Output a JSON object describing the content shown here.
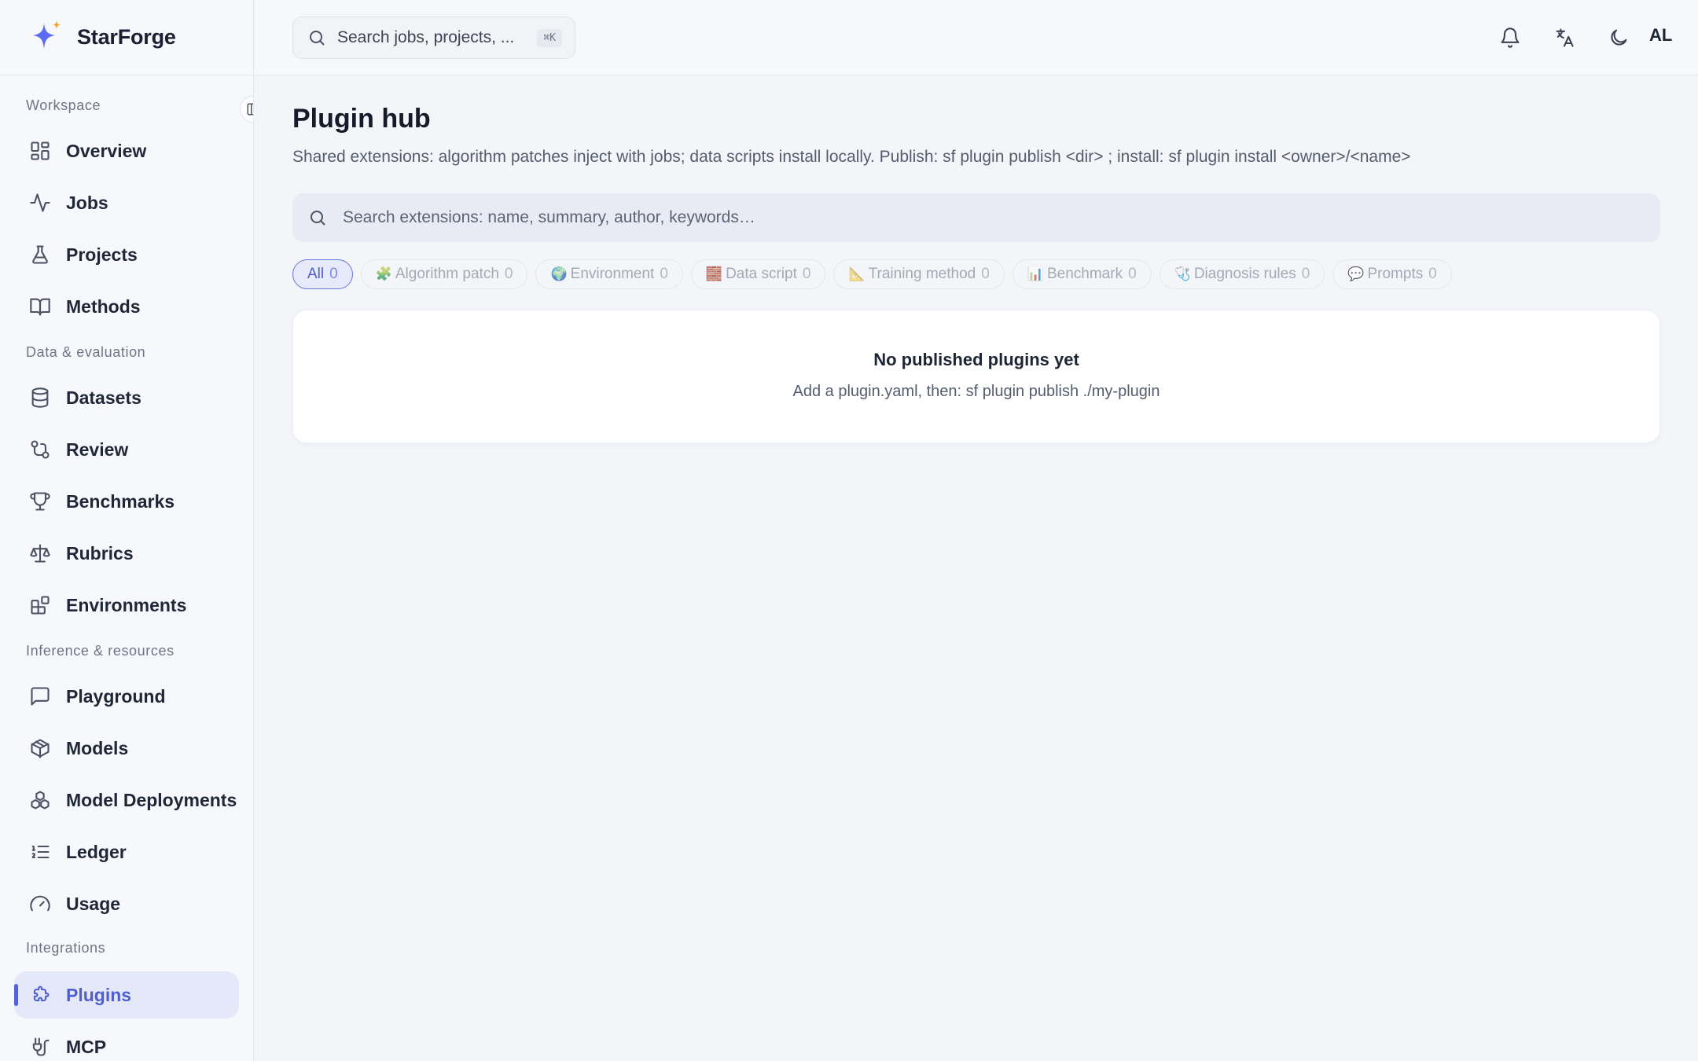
{
  "app": {
    "name": "StarForge"
  },
  "topbar": {
    "search_placeholder": "Search jobs, projects, ...",
    "search_shortcut": "⌘K",
    "avatar_initials": "AL"
  },
  "sidebar": {
    "sections": [
      {
        "label": "Workspace"
      },
      {
        "label": "Data & evaluation"
      },
      {
        "label": "Inference & resources"
      },
      {
        "label": "Integrations"
      }
    ],
    "items": [
      {
        "label": "Overview",
        "icon": "grid-icon"
      },
      {
        "label": "Jobs",
        "icon": "activity-icon"
      },
      {
        "label": "Projects",
        "icon": "flask-icon"
      },
      {
        "label": "Methods",
        "icon": "book-icon"
      },
      {
        "label": "Datasets",
        "icon": "database-icon"
      },
      {
        "label": "Review",
        "icon": "git-compare-icon"
      },
      {
        "label": "Benchmarks",
        "icon": "trophy-icon"
      },
      {
        "label": "Rubrics",
        "icon": "scale-icon"
      },
      {
        "label": "Environments",
        "icon": "blocks-icon"
      },
      {
        "label": "Playground",
        "icon": "message-square-icon"
      },
      {
        "label": "Models",
        "icon": "cube-icon"
      },
      {
        "label": "Model Deployments",
        "icon": "boxes-icon"
      },
      {
        "label": "Ledger",
        "icon": "list-ordered-icon"
      },
      {
        "label": "Usage",
        "icon": "gauge-icon"
      },
      {
        "label": "Plugins",
        "icon": "puzzle-icon",
        "active": true
      },
      {
        "label": "MCP",
        "icon": "plug-icon"
      }
    ]
  },
  "main": {
    "title": "Plugin hub",
    "description": "Shared extensions: algorithm patches inject with jobs; data scripts install locally. Publish: sf plugin publish <dir> ; install: sf plugin install <owner>/<name>",
    "search_placeholder": "Search extensions: name, summary, author, keywords…",
    "filters": [
      {
        "emoji": "",
        "label": "All",
        "count": "0",
        "active": true
      },
      {
        "emoji": "🧩",
        "label": "Algorithm patch",
        "count": "0"
      },
      {
        "emoji": "🌍",
        "label": "Environment",
        "count": "0"
      },
      {
        "emoji": "🧱",
        "label": "Data script",
        "count": "0"
      },
      {
        "emoji": "📐",
        "label": "Training method",
        "count": "0"
      },
      {
        "emoji": "📊",
        "label": "Benchmark",
        "count": "0"
      },
      {
        "emoji": "🩺",
        "label": "Diagnosis rules",
        "count": "0"
      },
      {
        "emoji": "💬",
        "label": "Prompts",
        "count": "0"
      }
    ],
    "empty_state": {
      "title": "No published plugins yet",
      "subtitle": "Add a plugin.yaml, then: sf plugin publish ./my-plugin"
    }
  },
  "colors": {
    "accent": "#5364d8",
    "active_bg": "#e4e8f9",
    "logo_main": "#5b6cf0",
    "logo_spark": "#f5a623"
  }
}
